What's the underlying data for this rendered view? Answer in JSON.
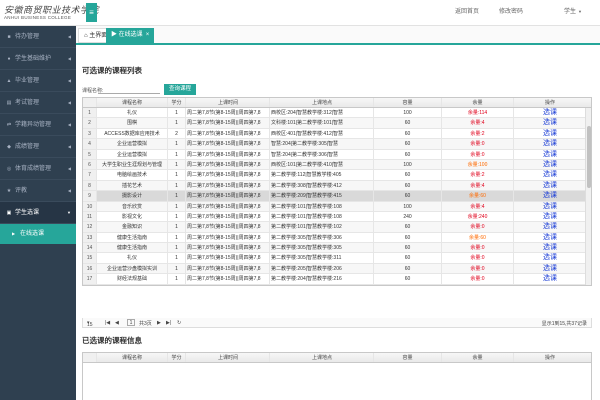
{
  "header": {
    "logo_cn": "安徽商贸职业技术学院",
    "logo_en": "ANHUI BUSINESS COLLEGE",
    "menu_icon": "hamburger-icon",
    "links": [
      "返回首页",
      "修改密码",
      "学生"
    ]
  },
  "sidebar": {
    "items": [
      {
        "label": "待办管理",
        "icon": "list-icon"
      },
      {
        "label": "学生基础维护",
        "icon": "user-icon"
      },
      {
        "label": "毕业管理",
        "icon": "graduation-icon"
      },
      {
        "label": "考试管理",
        "icon": "doc-icon"
      },
      {
        "label": "学籍异动管理",
        "icon": "swap-icon"
      },
      {
        "label": "成绩管理",
        "icon": "score-icon"
      },
      {
        "label": "体育成绩管理",
        "icon": "sport-icon"
      },
      {
        "label": "评教",
        "icon": "star-icon"
      },
      {
        "label": "学生选课",
        "icon": "book-icon"
      }
    ],
    "sub_item": "在线选课"
  },
  "tabs": {
    "home": "主界面",
    "active": "在线选课"
  },
  "available": {
    "title": "可选课的课程列表",
    "search_label": "课程名称:",
    "search_value": "",
    "search_button": "查询课程",
    "columns": [
      "",
      "课程名称",
      "学分",
      "上课时间",
      "上课地点",
      "容量",
      "余量",
      "操作"
    ],
    "rows": [
      {
        "idx": "1",
        "name": "礼仪",
        "credit": "1",
        "time": "周二第7,8节(第8-15周)|周四第7,8",
        "place": "西校区:204|智慧教学楼:312|智慧",
        "cap": "100",
        "rest": "余量:114",
        "rest_color": "red",
        "op": "选课"
      },
      {
        "idx": "2",
        "name": "围棋",
        "credit": "1",
        "time": "周二第7,8节(第8-15周)|周四第7,8",
        "place": "文科楼:101|第二教学楼:101|智慧",
        "cap": "60",
        "rest": "余量:4",
        "rest_color": "red",
        "op": "选课"
      },
      {
        "idx": "3",
        "name": "ACCESS数据库应用技术",
        "credit": "2",
        "time": "周二第7,8节(第8-15周)|周四第7,8",
        "place": "西校区:401|智慧教学楼:412|智慧",
        "cap": "60",
        "rest": "余量:2",
        "rest_color": "red",
        "op": "选课"
      },
      {
        "idx": "4",
        "name": "企业运营模拟",
        "credit": "1",
        "time": "周二第7,8节(第8-15周)|周四第7,8",
        "place": "智慧:204|第二教学楼:305|智慧",
        "cap": "60",
        "rest": "余量:0",
        "rest_color": "red",
        "op": "选课"
      },
      {
        "idx": "5",
        "name": "企业运营模拟",
        "credit": "1",
        "time": "周二第7,8节(第8-15周)|周四第7,8",
        "place": "智慧:204|第二教学楼:306|智慧",
        "cap": "60",
        "rest": "余量:0",
        "rest_color": "red",
        "op": "选课"
      },
      {
        "idx": "6",
        "name": "大学生职业生涯规划与管理",
        "credit": "1",
        "time": "周二第7,8节(第8-15周)|周四第7,8",
        "place": "西校区:101|第二教学楼:410|智慧",
        "cap": "100",
        "rest": "余量:100",
        "rest_color": "orange",
        "op": "选课"
      },
      {
        "idx": "7",
        "name": "电脑绘画技术",
        "credit": "1",
        "time": "周二第7,8节(第8-15周)|周四第7,8",
        "place": "第二教学楼:112|智慧教学楼:405",
        "cap": "60",
        "rest": "余量:2",
        "rest_color": "red",
        "op": "选课"
      },
      {
        "idx": "8",
        "name": "插花艺术",
        "credit": "1",
        "time": "周二第7,8节(第8-15周)|周四第7,8",
        "place": "第二教学楼:308|智慧教学楼:412",
        "cap": "60",
        "rest": "余量:4",
        "rest_color": "red",
        "op": "选课"
      },
      {
        "idx": "9",
        "name": "摄影设计",
        "credit": "1",
        "time": "周二第7,8节(第8-15周)|周四第7,8",
        "place": "第二教学楼:209|智慧教学楼:415",
        "cap": "60",
        "rest": "余量:60",
        "rest_color": "orange",
        "op": "选课"
      },
      {
        "idx": "10",
        "name": "音乐欣赏",
        "credit": "1",
        "time": "周二第7,8节(第8-15周)|周四第7,8",
        "place": "第二教学楼:101|智慧教学楼:108",
        "cap": "100",
        "rest": "余量:4",
        "rest_color": "red",
        "op": "选课"
      },
      {
        "idx": "11",
        "name": "影视文化",
        "credit": "1",
        "time": "周二第7,8节(第8-15周)|周四第7,8",
        "place": "第二教学楼:101|智慧教学楼:108",
        "cap": "240",
        "rest": "余量:240",
        "rest_color": "red",
        "op": "选课"
      },
      {
        "idx": "12",
        "name": "金融知识",
        "credit": "1",
        "time": "周二第7,8节(第8-15周)|周四第7,8",
        "place": "第二教学楼:101|智慧教学楼:102",
        "cap": "60",
        "rest": "余量:0",
        "rest_color": "red",
        "op": "选课"
      },
      {
        "idx": "13",
        "name": "健康生活指南",
        "credit": "1",
        "time": "周二第7,8节(第8-15周)|周四第7,8",
        "place": "第二教学楼:305|智慧教学楼:306",
        "cap": "60",
        "rest": "余量:60",
        "rest_color": "orange",
        "op": "选课"
      },
      {
        "idx": "14",
        "name": "健康生活指南",
        "credit": "1",
        "time": "周二第7,8节(第8-15周)|周四第7,8",
        "place": "第二教学楼:305|智慧教学楼:305",
        "cap": "60",
        "rest": "余量:0",
        "rest_color": "red",
        "op": "选课"
      },
      {
        "idx": "15",
        "name": "礼仪",
        "credit": "1",
        "time": "周二第7,8节(第8-15周)|周四第7,8",
        "place": "第二教学楼:305|智慧教学楼:311",
        "cap": "60",
        "rest": "余量:0",
        "rest_color": "red",
        "op": "选课"
      },
      {
        "idx": "16",
        "name": "企业运营沙盘模拟实训",
        "credit": "1",
        "time": "周二第7,8节(第8-15周)|周四第7,8",
        "place": "第二教学楼:205|智慧教学楼:206",
        "cap": "60",
        "rest": "余量:0",
        "rest_color": "red",
        "op": "选课"
      },
      {
        "idx": "17",
        "name": "财经法规基础",
        "credit": "1",
        "time": "周二第7,8节(第8-15周)|周四第7,8",
        "place": "第二教学楼:204|智慧教学楼:216",
        "cap": "60",
        "rest": "余量:0",
        "rest_color": "red",
        "op": "选课"
      }
    ],
    "selected_row": 8,
    "pager": {
      "page_size": "15",
      "page": "1",
      "total_pages": "共3页",
      "summary": "显示1到15,共37记录"
    }
  },
  "selected": {
    "title": "已选课的课程信息",
    "columns": [
      "课程名称",
      "学分",
      "上课时间",
      "上课地点",
      "容量",
      "余量",
      "操作"
    ]
  }
}
